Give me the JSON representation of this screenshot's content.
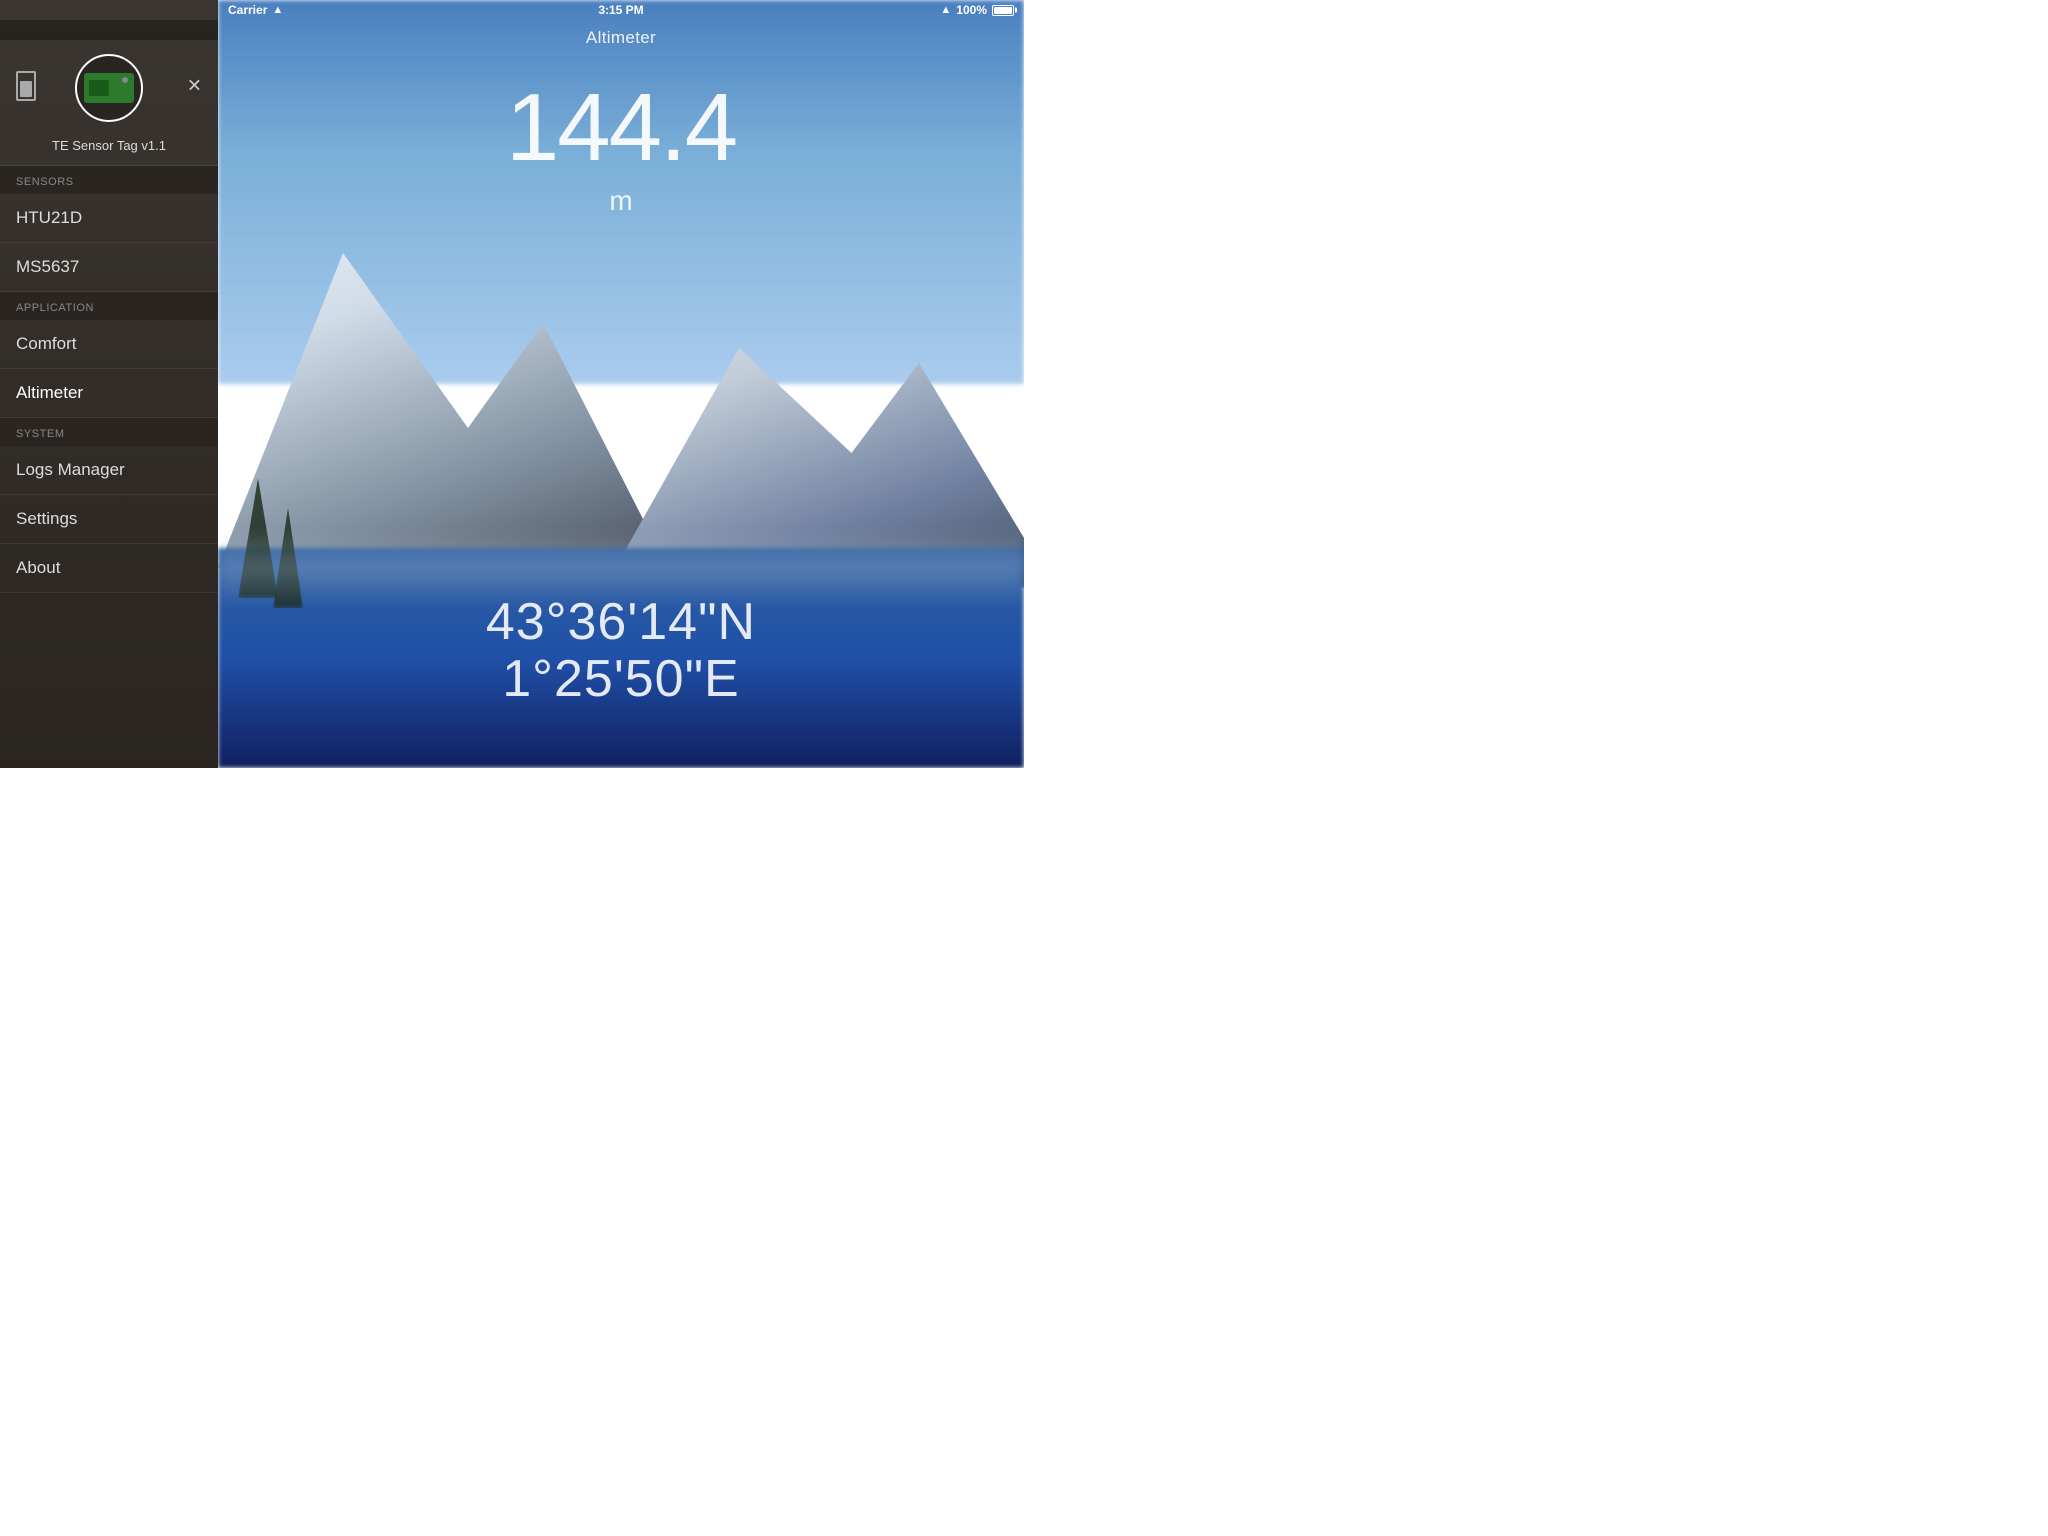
{
  "statusBar": {
    "carrier": "Carrier",
    "time": "3:15 PM",
    "batteryPercent": "100%",
    "wifiSymbol": "▲"
  },
  "sidebar": {
    "deviceName": "TE Sensor Tag v1.1",
    "sections": {
      "sensors": {
        "label": "SENSORS",
        "items": [
          {
            "id": "htu21d",
            "label": "HTU21D"
          },
          {
            "id": "ms5637",
            "label": "MS5637"
          }
        ]
      },
      "application": {
        "label": "APPLICATION",
        "items": [
          {
            "id": "comfort",
            "label": "Comfort"
          },
          {
            "id": "altimeter",
            "label": "Altimeter",
            "active": true
          }
        ]
      },
      "system": {
        "label": "SYSTEM",
        "items": [
          {
            "id": "logs-manager",
            "label": "Logs Manager"
          },
          {
            "id": "settings",
            "label": "Settings"
          },
          {
            "id": "about",
            "label": "About"
          }
        ]
      }
    },
    "closeButton": "✕"
  },
  "main": {
    "title": "Altimeter",
    "altitude": {
      "value": "144.4",
      "unit": "m"
    },
    "coordinates": {
      "latitude": "43°36'14\"N",
      "longitude": "1°25'50\"E"
    }
  }
}
